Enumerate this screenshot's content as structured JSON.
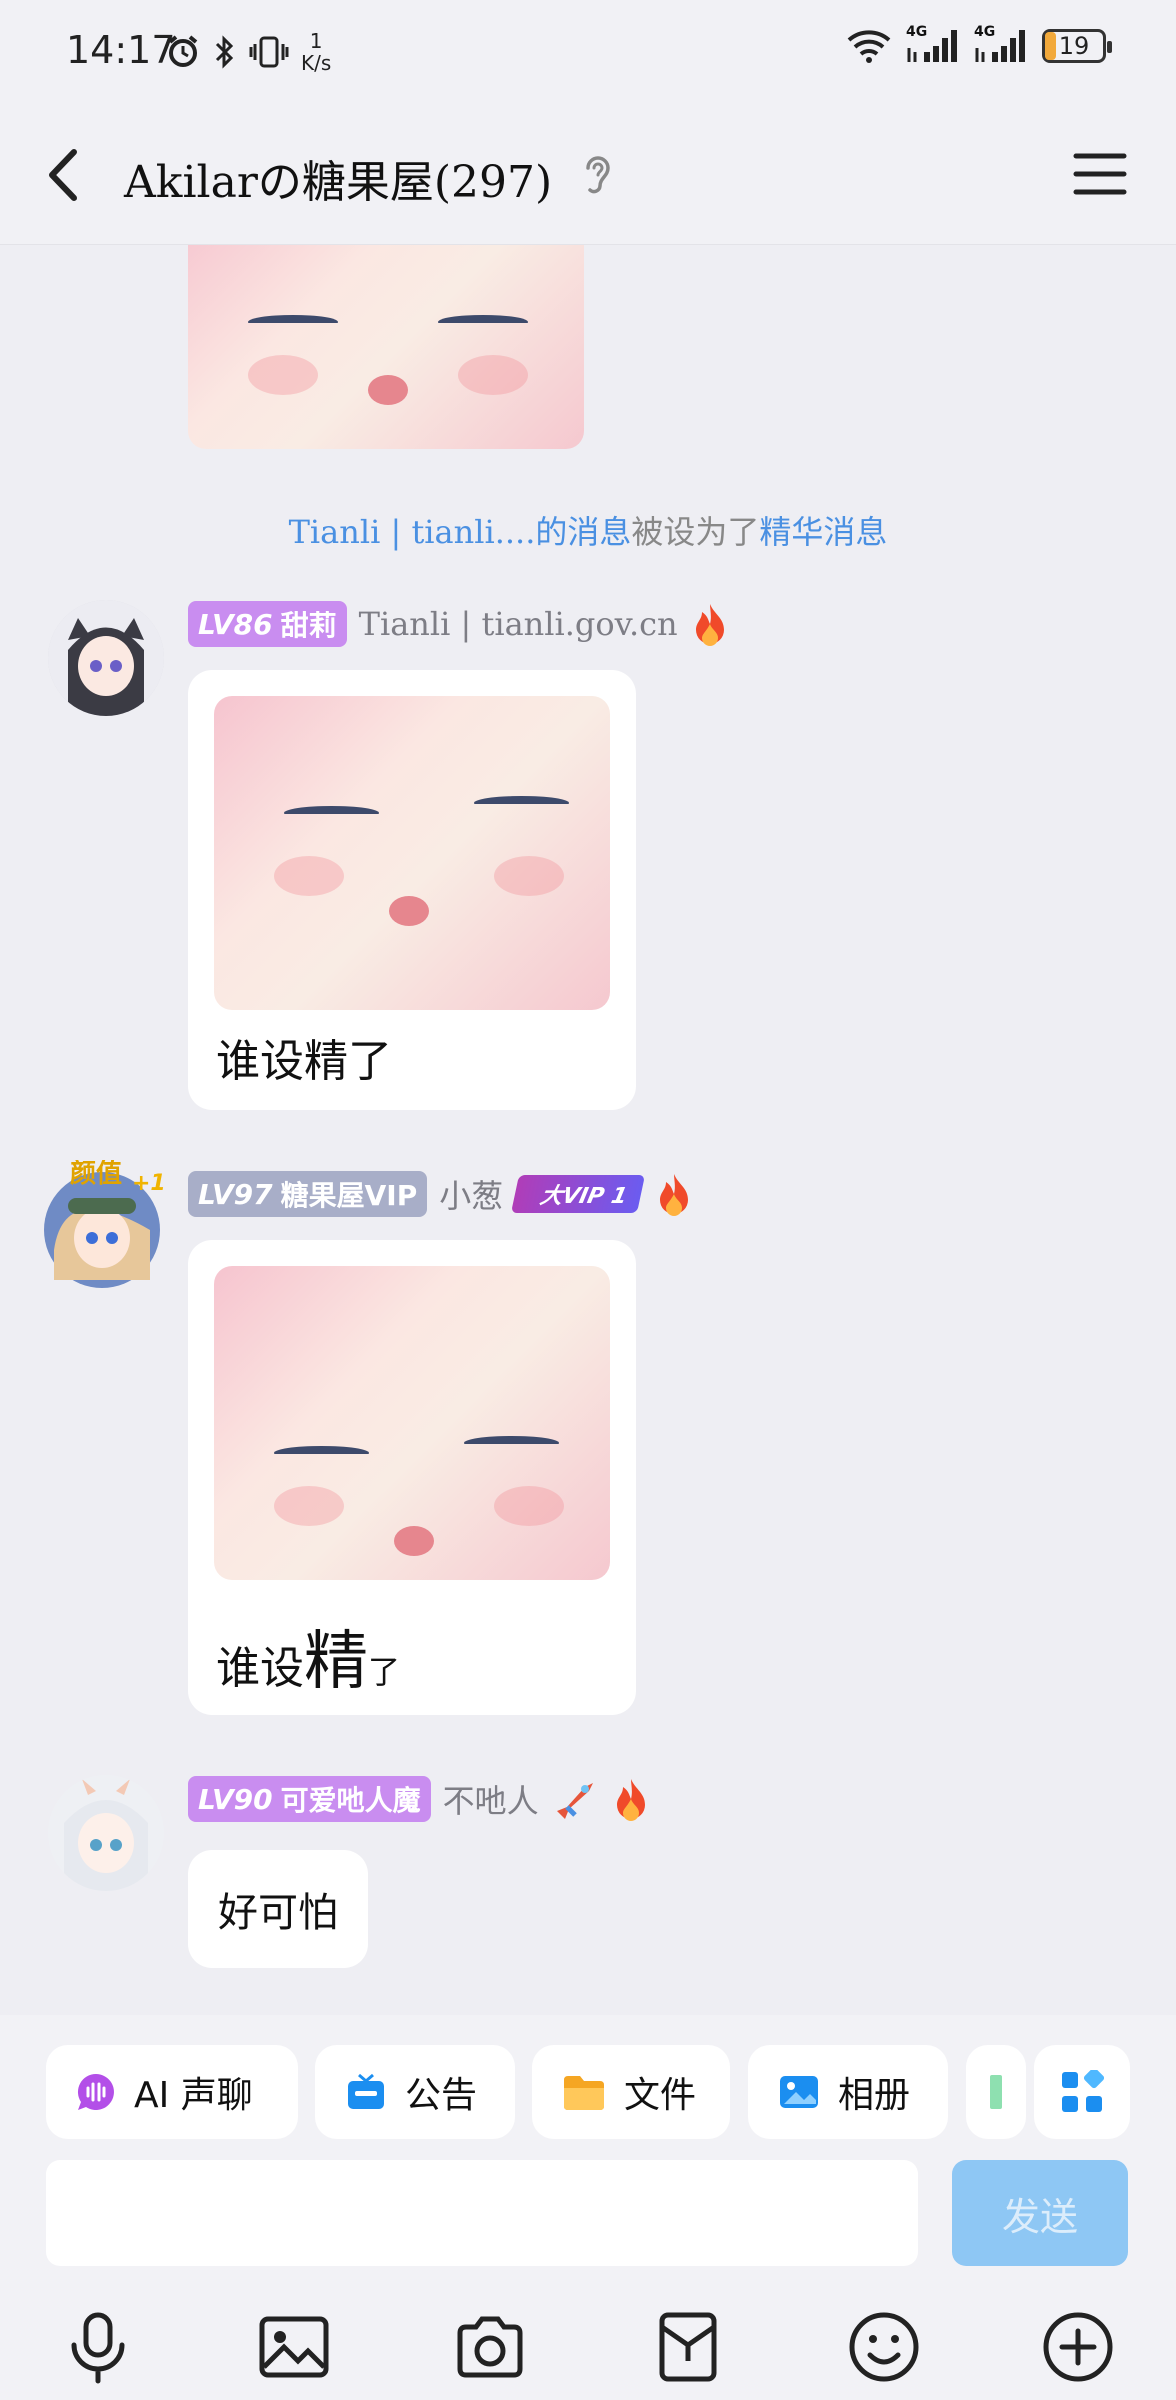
{
  "status_bar": {
    "time": "14:17",
    "speed_value": "1",
    "speed_unit": "K/s",
    "network_1": "4G",
    "network_2": "4G",
    "battery": "19",
    "battery_level": 0.19
  },
  "header": {
    "title": "Akilarの糖果屋(297)"
  },
  "chat": {
    "notice": {
      "sender": "Tianli | tianli....的消息",
      "action": "被设为了",
      "target": "精华消息"
    },
    "messages": [
      {
        "level": "LV86",
        "title": "甜莉",
        "badge_color": "#c98df0",
        "nickname": "Tianli | tianli.gov.cn",
        "caption": "谁设精了"
      },
      {
        "level": "LV97",
        "title": "糖果屋VIP",
        "badge_color": "#a8aec8",
        "nickname": "小葱",
        "vip_badge": "大VIP 1",
        "caption_a": "谁设",
        "caption_b": "精",
        "caption_c": "了",
        "avatar_tag": "颜值",
        "avatar_plus": "+1"
      },
      {
        "level": "LV90",
        "title": "可爱吔人魔",
        "badge_color": "#c98df0",
        "nickname": "不吔人",
        "text": "好可怕"
      }
    ]
  },
  "toolbar": {
    "quick_actions": [
      {
        "label": "AI 声聊",
        "icon": "ai-voice-icon"
      },
      {
        "label": "公告",
        "icon": "announcement-icon"
      },
      {
        "label": "文件",
        "icon": "folder-icon"
      },
      {
        "label": "相册",
        "icon": "album-icon"
      }
    ],
    "send_label": "发送",
    "input_placeholder": ""
  }
}
